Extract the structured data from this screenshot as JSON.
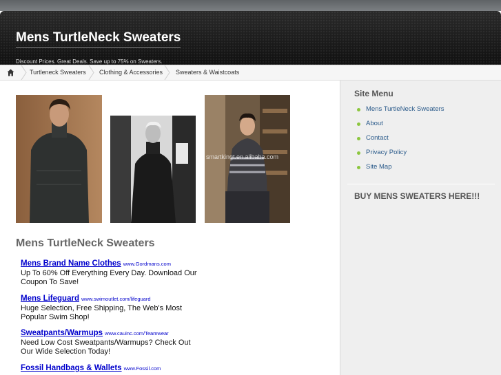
{
  "site": {
    "title": "Mens TurtleNeck Sweaters",
    "tagline": "Discount Prices. Great Deals. Save up to 75% on Sweaters."
  },
  "breadcrumb": {
    "home_icon": "home-icon",
    "items": [
      "Turtleneck Sweaters",
      "Clothing & Accessories",
      "Sweaters & Waistcoats"
    ]
  },
  "photos": {
    "watermark": "smartkingt.en.alibaba.com"
  },
  "main": {
    "heading": "Mens TurtleNeck Sweaters",
    "ads": [
      {
        "title": "Mens Brand Name Clothes",
        "url": "www.Gordmans.com",
        "desc": "Up To 60% Off Everything Every Day. Download Our Coupon To Save!"
      },
      {
        "title": "Mens Lifeguard",
        "url": "www.swimoutlet.com/lifeguard",
        "desc": "Huge Selection, Free Shipping, The Web's Most Popular Swim Shop!"
      },
      {
        "title": "Sweatpants/Warmups",
        "url": "www.cauinc.com/Teamwear",
        "desc": "Need Low Cost Sweatpants/Warmups? Check Out Our Wide Selection Today!"
      },
      {
        "title": "Fossil Handbags & Wallets",
        "url": "www.Fossil.com",
        "desc": ""
      }
    ]
  },
  "sidebar": {
    "menu_heading": "Site Menu",
    "menu_items": [
      "Mens TurtleNeck Sweaters",
      "About",
      "Contact",
      "Privacy Policy",
      "Site Map"
    ],
    "buy_heading": "BUY MENS SWEATERS HERE!!!",
    "colors": {
      "bullet": "#8cc63f",
      "link": "#2a5a8a"
    }
  }
}
